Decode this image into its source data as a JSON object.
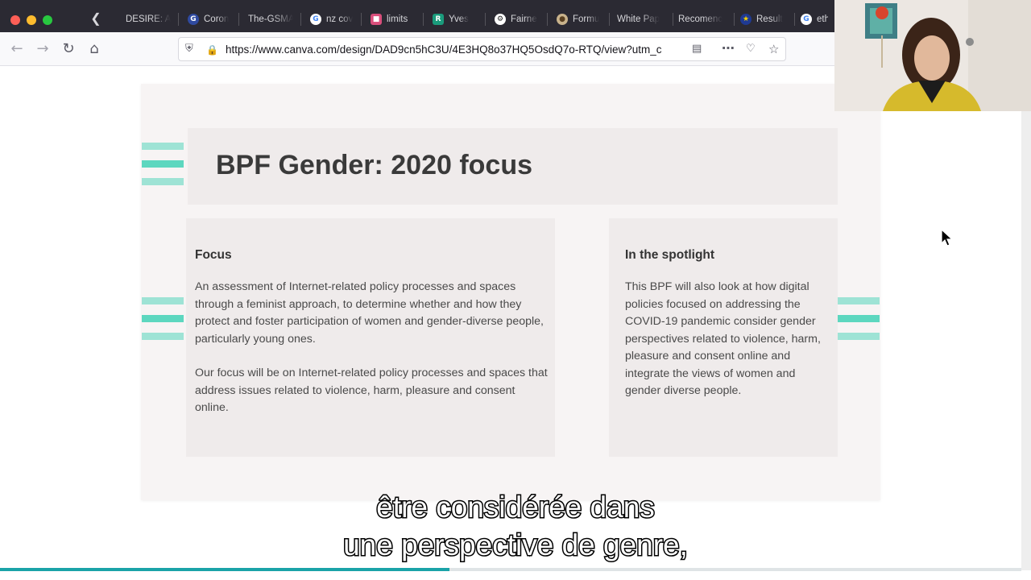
{
  "browser": {
    "tabs": [
      {
        "label": "DESIRE: A",
        "icon": "none",
        "color": "#2b2a33"
      },
      {
        "label": "Coron",
        "icon": "g-shield-icon",
        "color": "#2f4aa0"
      },
      {
        "label": "The-GSMA",
        "icon": "none",
        "color": "#2b2a33"
      },
      {
        "label": "nz cov",
        "icon": "google-icon",
        "color": "#ffffff"
      },
      {
        "label": "limits",
        "icon": "pixel-icon",
        "color": "#d94f7c"
      },
      {
        "label": "Yves",
        "icon": "r-icon",
        "color": "#1a9b7c"
      },
      {
        "label": "Fairne",
        "icon": "gear-icon",
        "color": "#ffffff"
      },
      {
        "label": "Formu",
        "icon": "circle-logo-icon",
        "color": "#c9b38c"
      },
      {
        "label": "White Pap",
        "icon": "none",
        "color": "#2b2a33"
      },
      {
        "label": "Recomenc",
        "icon": "none",
        "color": "#2b2a33"
      },
      {
        "label": "Result",
        "icon": "eu-flag-icon",
        "color": "#1f3a93"
      },
      {
        "label": "ethi",
        "icon": "google-icon",
        "color": "#ffffff"
      }
    ],
    "url": "https://www.canva.com/design/DAD9cn5hC3U/4E3HQ8o37HQ5OsdQ7o-RTQ/view?utm_c"
  },
  "slide": {
    "title": "BPF Gender: 2020 focus",
    "focus_card": {
      "heading": "Focus",
      "paragraph1": "An assessment of Internet-related policy processes and spaces through a  feminist approach, to determine whether and how they protect and foster participation of women and gender-diverse people, particularly young ones.",
      "paragraph2": "Our focus will be on Internet-related policy processes and spaces that address issues related to violence, harm, pleasure and consent online."
    },
    "spotlight_card": {
      "heading": "In the spotlight",
      "paragraph": "This BPF will also look at how digital policies focused on addressing the COVID-19 pandemic consider gender perspectives related to violence, harm, pleasure and consent online and integrate the views of women and gender diverse people."
    },
    "accent_color": "#5dd7bf"
  },
  "subtitles": {
    "line1": "être considérée dans",
    "line2": "une perspective de genre,"
  },
  "video": {
    "progress": 0.44,
    "progress_color": "#1aa3a8"
  }
}
